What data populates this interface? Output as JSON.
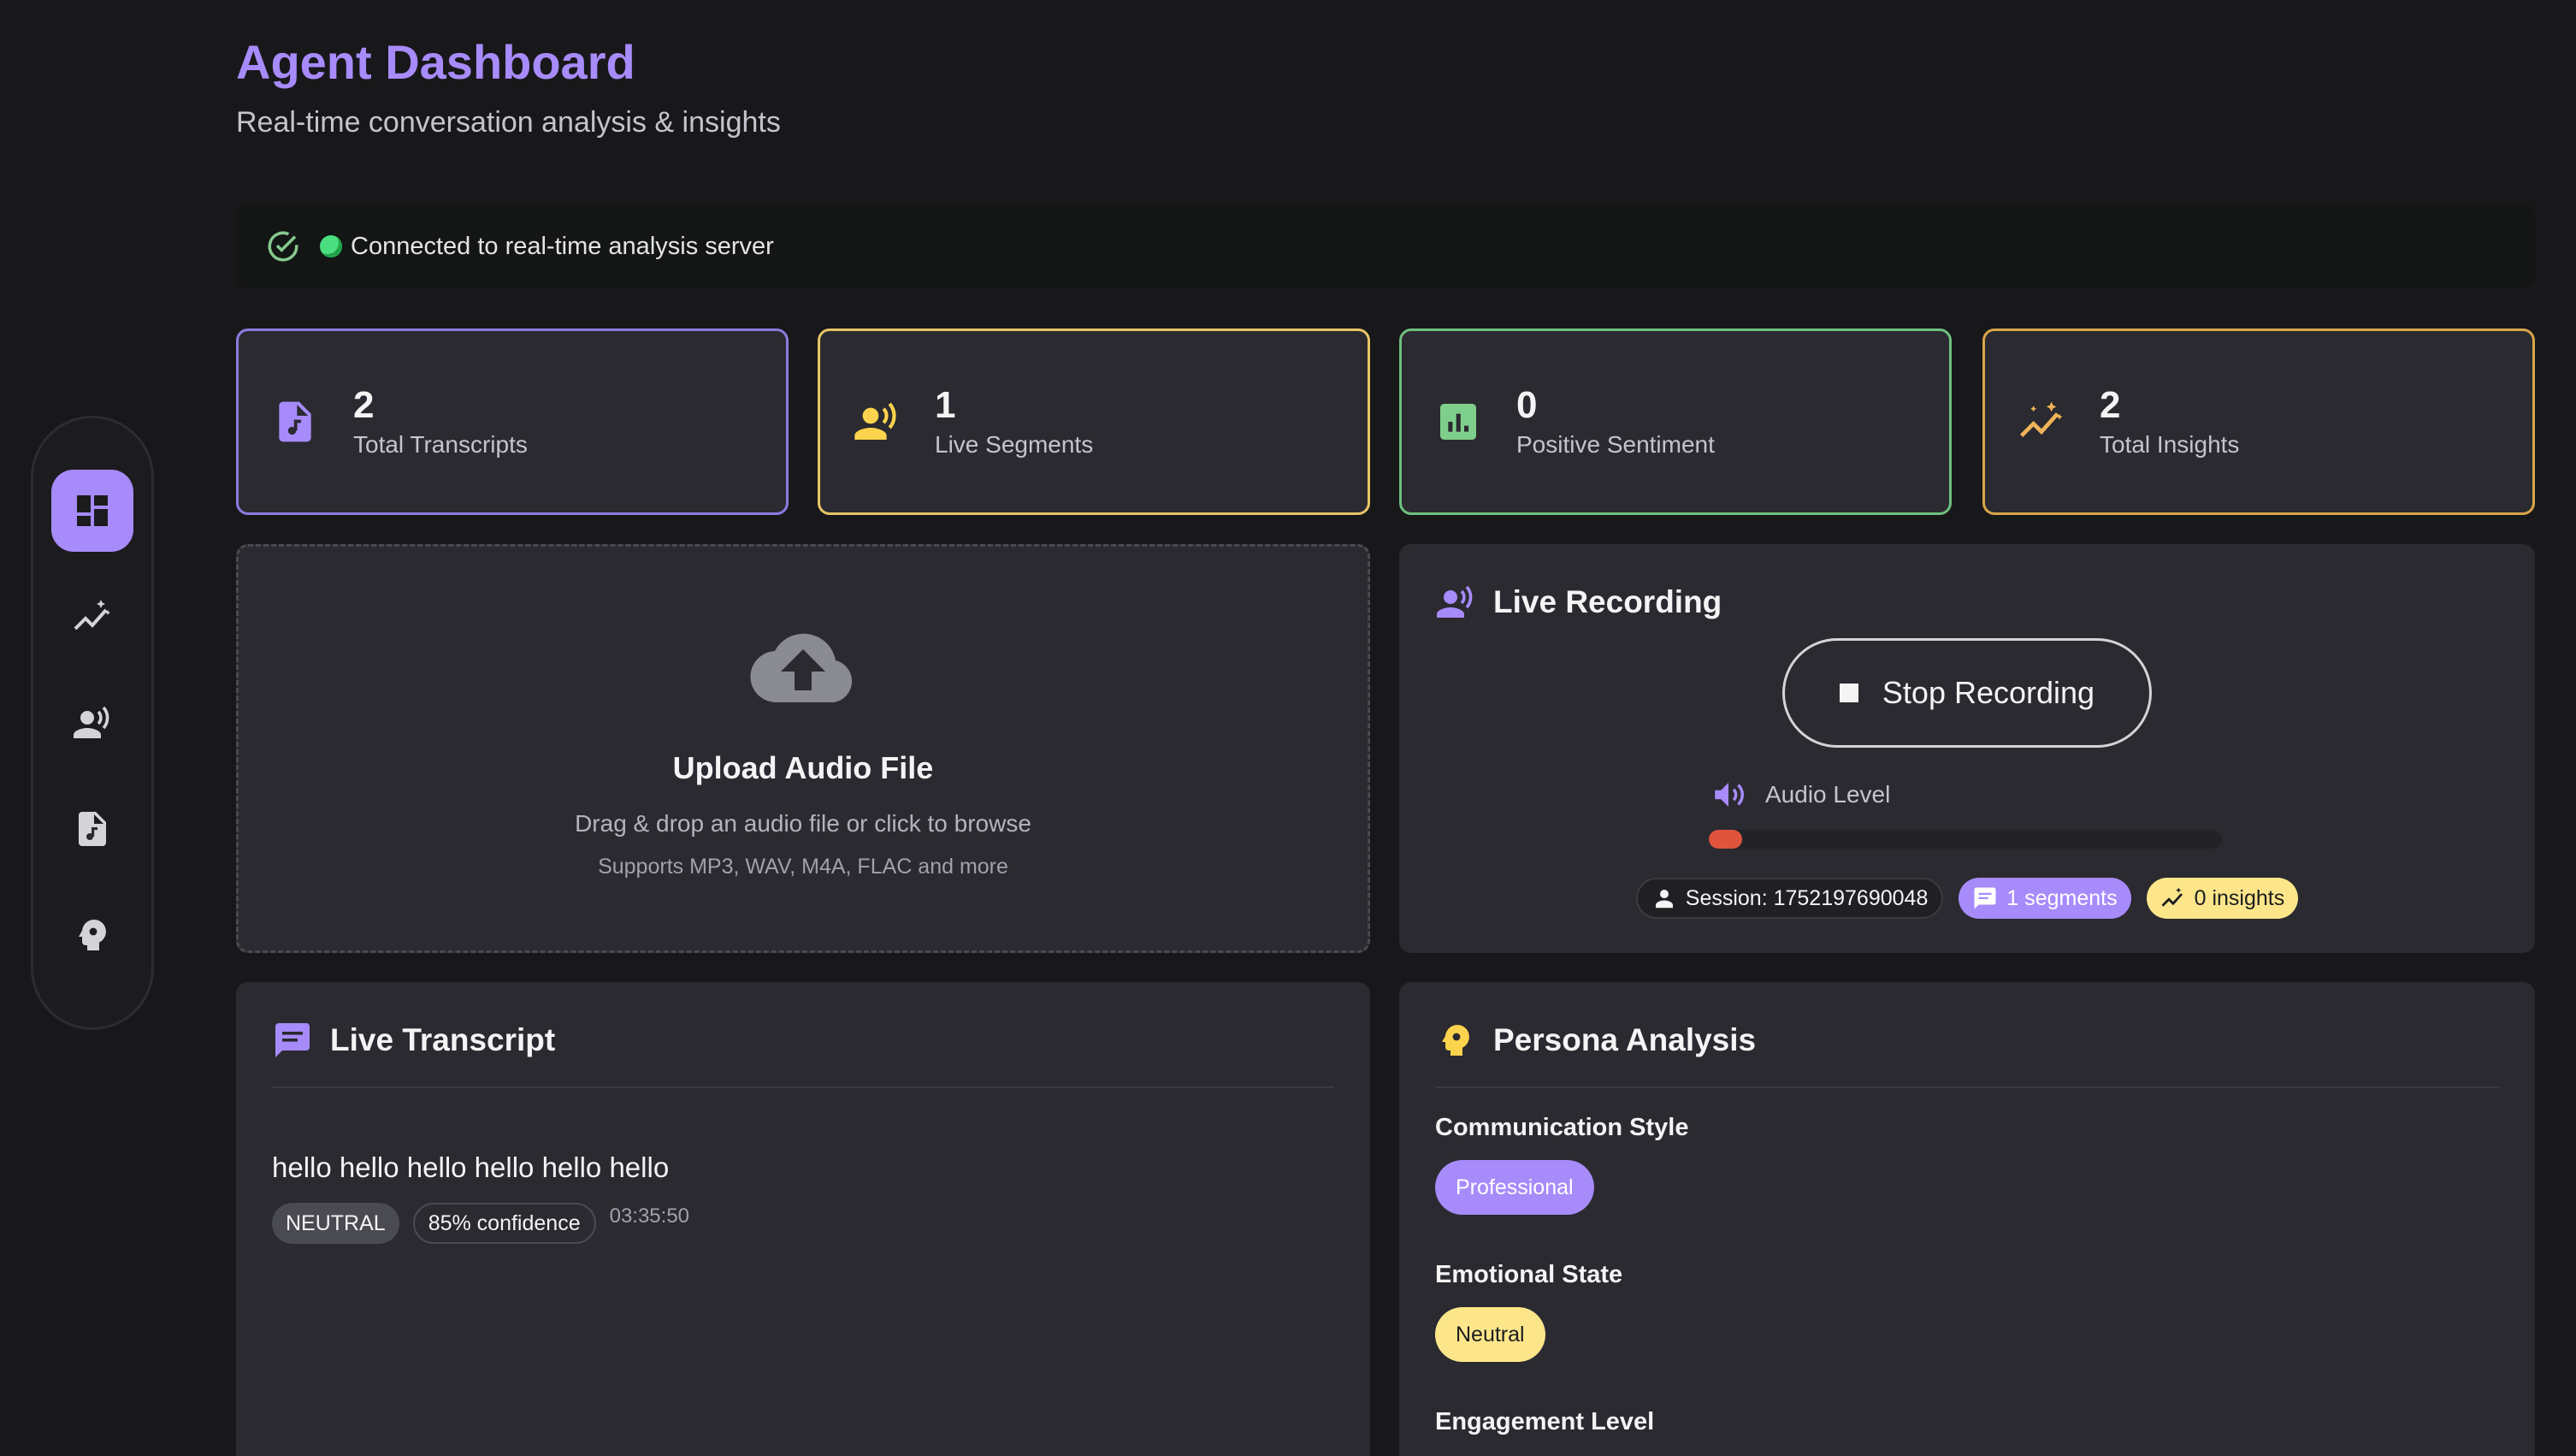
{
  "header": {
    "title": "Agent Dashboard",
    "subtitle": "Real-time conversation analysis & insights"
  },
  "connection": {
    "status_text": "Connected to real-time analysis server",
    "status_color": "#4ade80"
  },
  "nav": {
    "items": [
      {
        "name": "dashboard-icon",
        "active": true
      },
      {
        "name": "insights-icon",
        "active": false
      },
      {
        "name": "speaker-icon",
        "active": false
      },
      {
        "name": "audio-file-icon",
        "active": false
      },
      {
        "name": "persona-icon",
        "active": false
      }
    ]
  },
  "stats": [
    {
      "value": "2",
      "label": "Total Transcripts",
      "icon": "audio-file-icon",
      "color": "#a78bfa"
    },
    {
      "value": "1",
      "label": "Live Segments",
      "icon": "speaker-icon",
      "color": "#fcd34d"
    },
    {
      "value": "0",
      "label": "Positive Sentiment",
      "icon": "chart-icon",
      "color": "#86efac"
    },
    {
      "value": "2",
      "label": "Total Insights",
      "icon": "insights-icon",
      "color": "#f0b458"
    }
  ],
  "upload": {
    "title": "Upload Audio File",
    "description": "Drag & drop an audio file or click to browse",
    "supported": "Supports MP3, WAV, M4A, FLAC and more"
  },
  "recording": {
    "title": "Live Recording",
    "stop_label": "Stop Recording",
    "audio_level_label": "Audio Level",
    "audio_level": 0.065,
    "session_label": "Session: 1752197690048",
    "segments_label": "1 segments",
    "insights_label": "0 insights"
  },
  "transcript": {
    "title": "Live Transcript",
    "text": "hello hello hello hello hello hello",
    "sentiment": "NEUTRAL",
    "confidence": "85% confidence",
    "time": "03:35:50"
  },
  "persona": {
    "title": "Persona Analysis",
    "communication_label": "Communication Style",
    "communication_value": "Professional",
    "emotional_label": "Emotional State",
    "emotional_value": "Neutral",
    "engagement_label": "Engagement Level"
  },
  "colors": {
    "accent": "#a78bfa",
    "background": "#18181b",
    "card": "#2a2a30",
    "recording": "#e0533d"
  }
}
